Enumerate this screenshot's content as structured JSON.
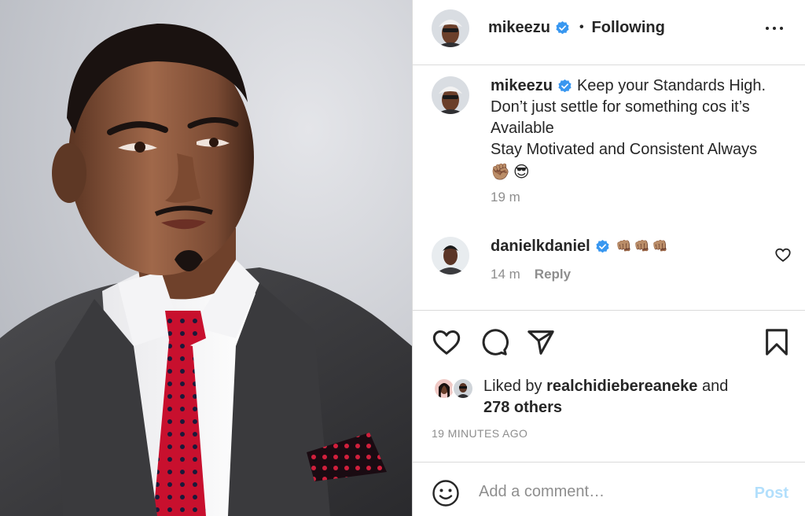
{
  "post": {
    "author": "mikeezu",
    "follow_status": "Following",
    "dot": "•",
    "caption_lines": [
      "Keep your Standards High.",
      "Don’t just settle for something cos it’s",
      "Available",
      "Stay Motivated and Consistent Always"
    ],
    "caption_emojis": [
      "✊🏽",
      "😎"
    ],
    "caption_time": "19 m",
    "likes": {
      "prefix": "Liked by",
      "user": "realchidiebereaneke",
      "and": "and",
      "others": "278 others"
    },
    "timestamp": "19 MINUTES AGO"
  },
  "comment": {
    "author": "danielkdaniel",
    "emojis": [
      "👊🏽",
      "👊🏽",
      "👊🏽"
    ],
    "time": "14 m",
    "reply_label": "Reply"
  },
  "comment_box": {
    "placeholder": "Add a comment…",
    "post_label": "Post"
  },
  "colors": {
    "verified": "#3897f0",
    "post_button_disabled": "#b2dffc",
    "muted_text": "#8e8e8e",
    "divider": "#dbdbdb"
  },
  "icons": [
    "verified-badge-icon",
    "more-options-icon",
    "heart-icon",
    "comment-icon",
    "share-icon",
    "bookmark-icon",
    "emoji-icon"
  ]
}
